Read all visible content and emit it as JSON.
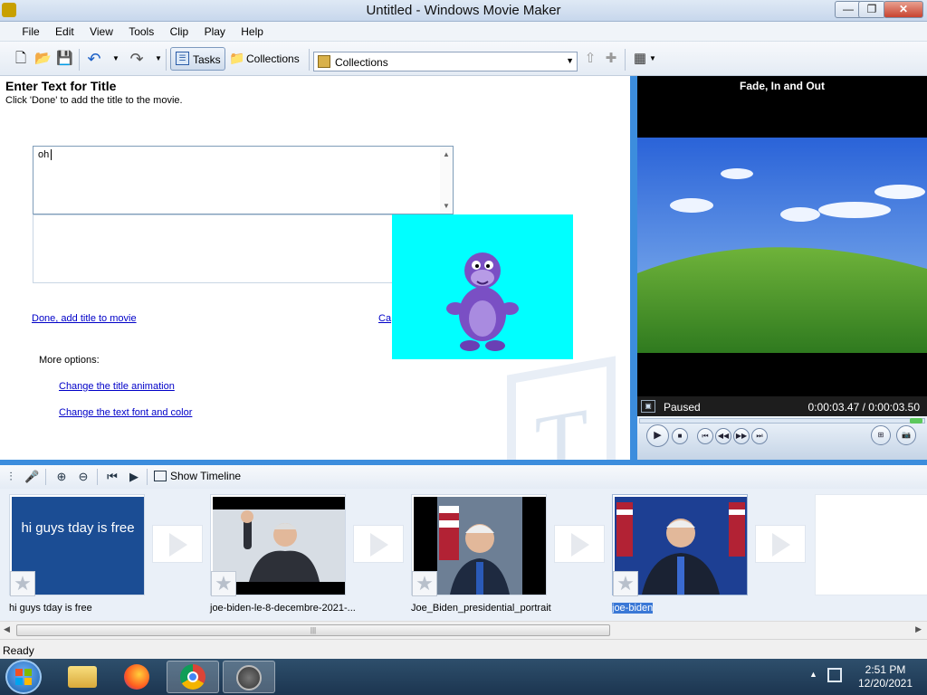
{
  "window": {
    "title": "Untitled - Windows Movie Maker"
  },
  "window_controls": {
    "minimize": "—",
    "maximize": "❐",
    "close": "✕"
  },
  "menu": [
    "File",
    "Edit",
    "View",
    "Tools",
    "Clip",
    "Play",
    "Help"
  ],
  "toolbar": {
    "tasks_label": "Tasks",
    "collections_label": "Collections",
    "collections_select": "Collections"
  },
  "task_pane": {
    "heading": "Enter Text for Title",
    "subheading": "Click 'Done' to add the title to the movie.",
    "title_text": "oh",
    "done_link": "Done, add title to movie",
    "cancel_link": "Ca",
    "more_options": "More options:",
    "change_animation_link": "Change the title animation",
    "change_font_link": "Change the text font and color"
  },
  "preview": {
    "title": "Fade, In and Out",
    "status": "Paused",
    "time": "0:00:03.47 / 0:00:03.50"
  },
  "storyboard_toolbar": {
    "show_timeline": "Show Timeline"
  },
  "storyboard": {
    "clips": [
      {
        "label": "hi guys tday is free",
        "thumb_text": "hi guys tday is free"
      },
      {
        "label": "joe-biden-le-8-decembre-2021-..."
      },
      {
        "label": "Joe_Biden_presidential_portrait"
      },
      {
        "label": "joe-biden"
      }
    ]
  },
  "scrollbar": {
    "grip": "|||"
  },
  "status_bar": {
    "text": "Ready"
  },
  "taskbar": {
    "time": "2:51 PM",
    "date": "12/20/2021"
  }
}
